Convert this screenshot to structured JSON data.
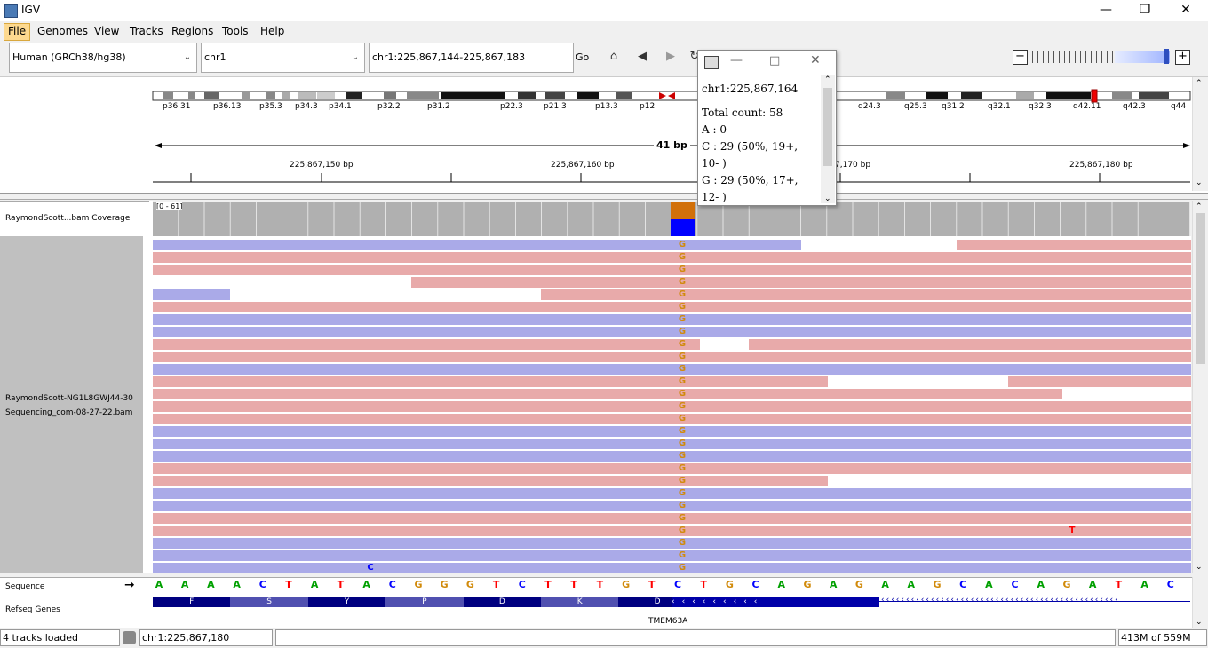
{
  "window": {
    "title": "IGV"
  },
  "menu": [
    "File",
    "Genomes",
    "View",
    "Tracks",
    "Regions",
    "Tools",
    "Help"
  ],
  "toolbar": {
    "genome": "Human (GRCh38/hg38)",
    "chromosome": "chr1",
    "locus": "chr1:225,867,144-225,867,183",
    "go_label": "Go"
  },
  "ideogram": {
    "bands": [
      "p36.31",
      "p36.13",
      "p35.3",
      "p34.3",
      "p34.1",
      "p32.2",
      "p31.2",
      "p22.3",
      "p21.3",
      "p13.3",
      "p12",
      ".3",
      "q24.3",
      "q25.3",
      "q31.2",
      "q32.1",
      "q32.3",
      "q42.11",
      "q42.3",
      "q44"
    ],
    "span_label": "41 bp",
    "ruler_labels": [
      "225,867,150 bp",
      "225,867,160 bp",
      "7,170 bp",
      "225,867,180 bp"
    ]
  },
  "tracks": {
    "coverage_name": "RaymondScott...bam Coverage",
    "coverage_range": "[0 - 61]",
    "bam_name_line1": "RaymondScott-NG1L8GWJ44-30",
    "bam_name_line2": "Sequencing_com-08-27-22.bam",
    "mismatch_base": "G",
    "other_mismatch_1": "T",
    "other_mismatch_2": "C",
    "sequence_label": "Sequence",
    "refseq_label": "Refseq Genes",
    "gene_name": "TMEM63A",
    "sequence": [
      "A",
      "A",
      "A",
      "A",
      "C",
      "T",
      "A",
      "T",
      "A",
      "C",
      "G",
      "G",
      "G",
      "T",
      "C",
      "T",
      "T",
      "T",
      "G",
      "T",
      "C",
      "T",
      "G",
      "C",
      "A",
      "G",
      "A",
      "G",
      "A",
      "A",
      "G",
      "C",
      "A",
      "C",
      "A",
      "G",
      "A",
      "T",
      "A",
      "C"
    ],
    "amino_acids": [
      "F",
      "S",
      "Y",
      "P",
      "D",
      "K",
      "D"
    ]
  },
  "popup": {
    "locus": "chr1:225,867,164",
    "total": "Total count: 58",
    "a": "A : 0",
    "c1": "C : 29 (50%, 19+,",
    "c2": "10- )",
    "g1": "G : 29 (50%, 17+,",
    "g2": "12- )"
  },
  "status": {
    "tracks_loaded": "4 tracks loaded",
    "position": "chr1:225,867,180",
    "memory": "413M of 559M"
  },
  "colors": {
    "pink_read": "#e8aaaa",
    "blue_read": "#aaaae8",
    "coverage": "#b0b0b0",
    "c_color": "#0000ff",
    "g_color": "#d18a0a",
    "t_color": "#ff0000",
    "a_color": "#00a000"
  }
}
